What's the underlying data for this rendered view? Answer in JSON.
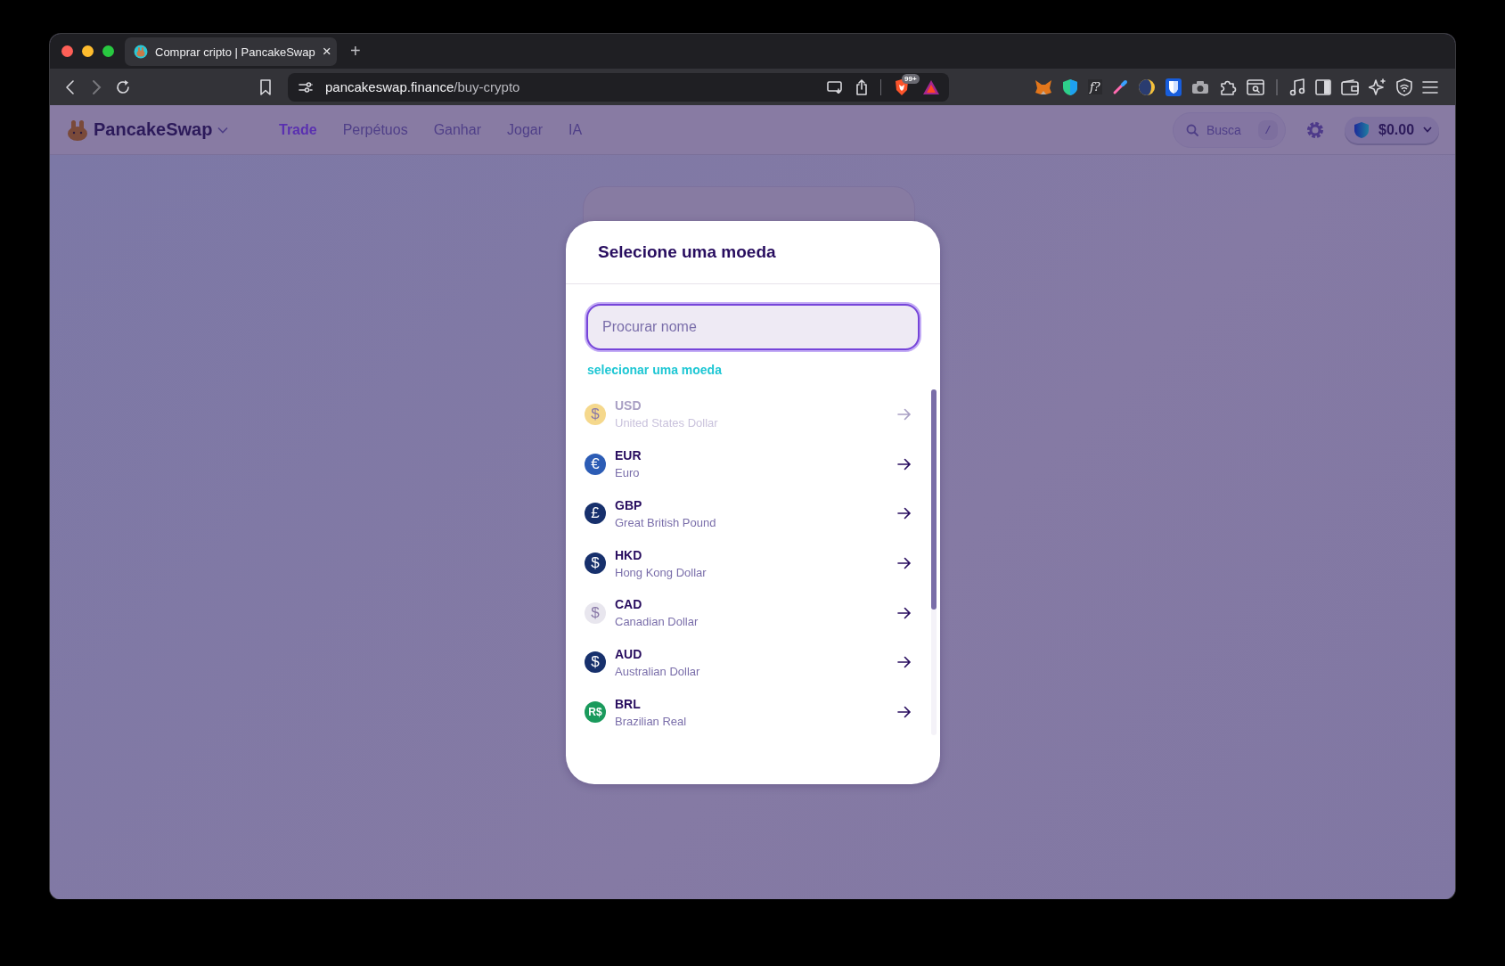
{
  "browser": {
    "tab": {
      "title": "Comprar cripto | PancakeSwap",
      "close": "×",
      "new_tab": "+"
    },
    "address": {
      "host": "pancakeswap.finance",
      "path": "/buy-crypto"
    },
    "shields_badge": "99+",
    "extension_label": "f?"
  },
  "nav": {
    "logo": "PancakeSwap",
    "items": [
      {
        "label": "Trade",
        "selected": true
      },
      {
        "label": "Perpétuos",
        "selected": false
      },
      {
        "label": "Ganhar",
        "selected": false
      },
      {
        "label": "Jogar",
        "selected": false
      },
      {
        "label": "IA",
        "selected": false
      }
    ],
    "search": {
      "placeholder": "Busca",
      "shortcut": "/"
    },
    "balance": "$0.00"
  },
  "card": {
    "kind": "panel"
  },
  "modal": {
    "title": "Selecione uma moeda",
    "search": {
      "placeholder": "Procurar nome"
    },
    "section_label": "selecionar uma moeda",
    "currencies": [
      {
        "code": "USD",
        "name": "United States Dollar",
        "symbol": "$",
        "color": "#f5d88c",
        "disabled": true
      },
      {
        "code": "EUR",
        "name": "Euro",
        "symbol": "€",
        "color": "#2c5cb5",
        "disabled": false
      },
      {
        "code": "GBP",
        "name": "Great British Pound",
        "symbol": "£",
        "color": "#17306c",
        "disabled": false
      },
      {
        "code": "HKD",
        "name": "Hong Kong Dollar",
        "symbol": "$",
        "color": "#17306c",
        "disabled": false
      },
      {
        "code": "CAD",
        "name": "Canadian Dollar",
        "symbol": "$",
        "color": "#e8e6ee",
        "disabled": false
      },
      {
        "code": "AUD",
        "name": "Australian Dollar",
        "symbol": "$",
        "color": "#17306c",
        "disabled": false
      },
      {
        "code": "BRL",
        "name": "Brazilian Real",
        "symbol": "R$",
        "color": "#1a9a5c",
        "disabled": false
      }
    ]
  }
}
